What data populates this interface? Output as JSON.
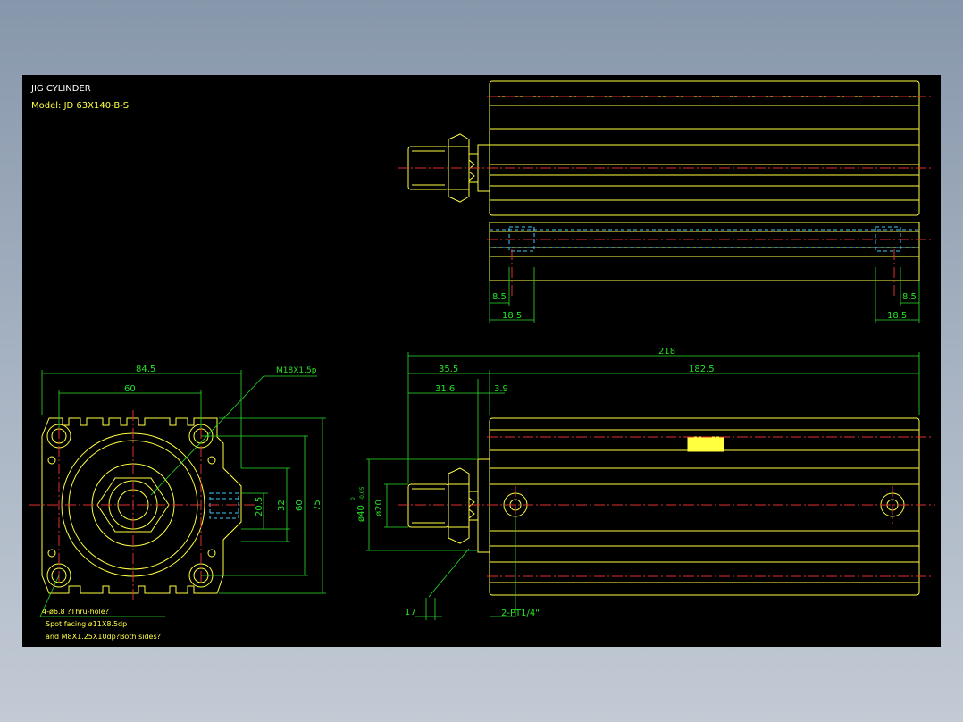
{
  "title": {
    "name": "JIG CYLINDER",
    "model": "Model: JD 63X140-B-S"
  },
  "colors": {
    "background": "#000000",
    "outline": "#ffff40",
    "dimension": "#28e028",
    "centerline": "#e03030",
    "hidden": "#40c8ff",
    "text_white": "#ffffff"
  },
  "dimensions": {
    "top_left_small": "8.5",
    "top_left_large": "18.5",
    "top_right_small": "8.5",
    "top_right_large": "18.5",
    "overall_length": "218",
    "rod_extension": "35.5",
    "body_length": "182.5",
    "rod_length": "31.6",
    "flange": "3.9",
    "thread_len": "17",
    "side_width": "84.5",
    "side_pitch": "60",
    "side_h_20": "20.5",
    "side_h_32": "32",
    "side_h_60": "60",
    "side_h_75": "75",
    "dia_40": "ø40",
    "dia_40_tol": "-0.05",
    "dia_40_tol_up": "0",
    "dia_20": "ø20"
  },
  "notes": {
    "thread": "M18X1.5p",
    "port": "2-PT1/4\"",
    "holes_line1": "4-ø6.8  ?Thru-hole?",
    "holes_line2": "Spot facing  ø11X8.5dp",
    "holes_line3": "and M8X1.25X10dp?Both sides?"
  }
}
